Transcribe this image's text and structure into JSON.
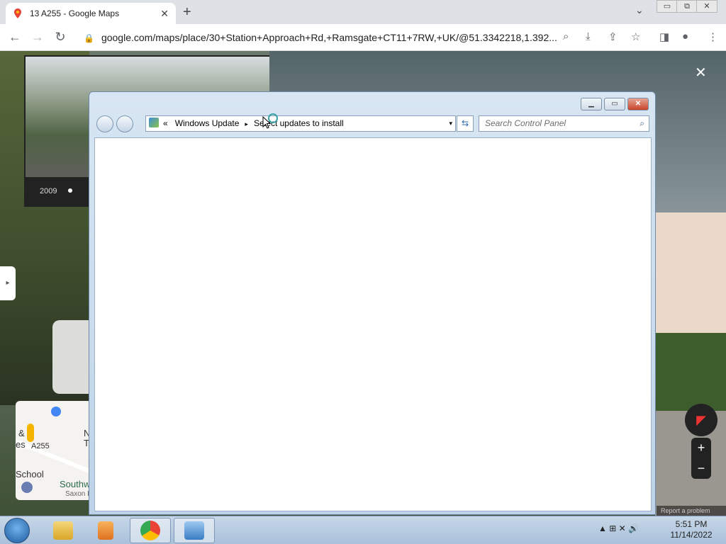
{
  "browser": {
    "tab": {
      "title": "13 A255 - Google Maps",
      "close": "✕",
      "favicon": "maps-pin-icon"
    },
    "new_tab": "+",
    "tab_menu": "⌄",
    "window_controls": [
      "▭",
      "⧉",
      "✕"
    ],
    "url": "google.com/maps/place/30+Station+Approach+Rd,+Ramsgate+CT11+7RW,+UK/@51.3342218,1.392...",
    "nav": {
      "back": "←",
      "forward": "→",
      "reload": "↻"
    },
    "toolbar_icons": [
      "⌕",
      "⤓",
      "⇪",
      "☆",
      "◨",
      "●",
      "⋮"
    ]
  },
  "streetview": {
    "thumb_year": "2009",
    "close": "✕",
    "side_toggle": "▸",
    "minimap": {
      "labels": [
        "&",
        "es",
        "A255",
        "N",
        "T",
        "School",
        "Southw",
        "Saxon P"
      ]
    },
    "compass": "◤",
    "zoom_in": "+",
    "zoom_out": "−",
    "report": "Report a problem"
  },
  "explorer": {
    "controls": {
      "minimize": "▁",
      "maximize": "▭",
      "close": "✕"
    },
    "breadcrumb": {
      "chevron": "«",
      "root": "Windows Update",
      "separator": "▸",
      "current": "Select updates to install"
    },
    "dropdown": "▾",
    "refresh": "⇆",
    "search_placeholder": "Search Control Panel",
    "search_icon": "⌕"
  },
  "taskbar": {
    "apps": [
      "explorer",
      "media-player",
      "chrome",
      "control-panel"
    ],
    "tray_icons": "▲ ⊞ ✕ 🔊",
    "time": "5:51 PM",
    "date": "11/14/2022"
  }
}
